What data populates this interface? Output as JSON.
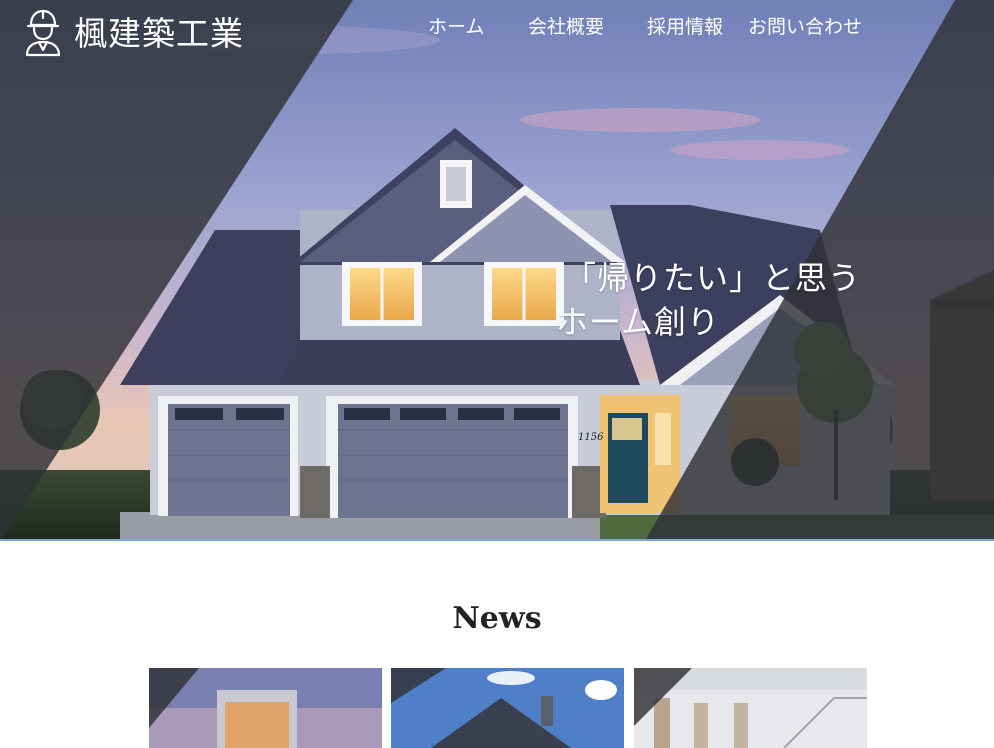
{
  "header": {
    "logo_text": "楓建築工業",
    "logo_icon": "worker-helmet-icon"
  },
  "nav": {
    "items": [
      {
        "label": "ホーム"
      },
      {
        "label": "会社概要"
      },
      {
        "label": "採用情報"
      },
      {
        "label": "お問い合わせ"
      }
    ]
  },
  "hero": {
    "tagline_line1": "「帰りたい」と思う",
    "tagline_line2": "ホーム創り",
    "house_number": "1156"
  },
  "news": {
    "title": "News"
  },
  "colors": {
    "overlay": "#2f3136",
    "accent_border": "#7fa8d8"
  }
}
